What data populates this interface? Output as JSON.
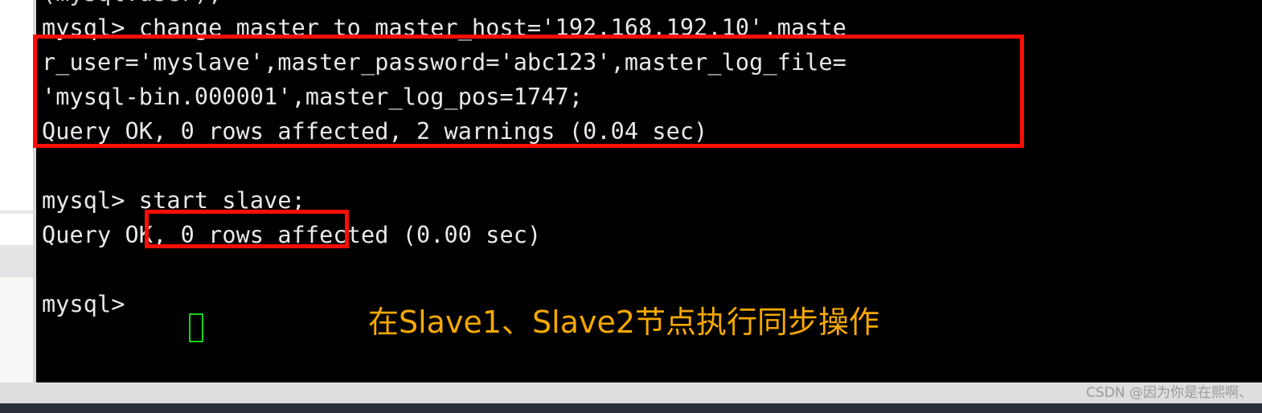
{
  "terminal": {
    "prompt": "mysql>",
    "lines": [
      {
        "text": "(mysql.user);",
        "clipped": true
      },
      {
        "text": "mysql> change master to master_host='192.168.192.10',maste",
        "clipped": false
      },
      {
        "text": "r_user='myslave',master_password='abc123',master_log_file=",
        "clipped": false
      },
      {
        "text": "'mysql-bin.000001',master_log_pos=1747;",
        "clipped": false
      },
      {
        "text": "Query OK, 0 rows affected, 2 warnings (0.04 sec)",
        "clipped": false
      },
      {
        "text": "",
        "clipped": false
      },
      {
        "text": "mysql> start slave;",
        "clipped": false
      },
      {
        "text": "Query OK, 0 rows affected (0.00 sec)",
        "clipped": false
      },
      {
        "text": "",
        "clipped": false
      },
      {
        "text": "mysql>",
        "clipped": false
      }
    ],
    "commands": {
      "change_master": "change master to master_host='192.168.192.10',master_user='myslave',master_password='abc123',master_log_file='mysql-bin.000001',master_log_pos=1747;",
      "start_slave": "start slave;"
    },
    "results": {
      "change_master_result": "Query OK, 0 rows affected, 2 warnings (0.04 sec)",
      "start_slave_result": "Query OK, 0 rows affected (0.00 sec)"
    },
    "background_color": "#000000",
    "text_color": "#e9e9e9",
    "cursor_color": "#15d415"
  },
  "annotations": {
    "highlight_color": "#fb0e06",
    "note_color": "#f5a800",
    "note_text": "在Slave1、Slave2节点执行同步操作",
    "boxes": [
      {
        "label": "change-master-command"
      },
      {
        "label": "start-slave-command"
      }
    ]
  },
  "footer": {
    "watermark": "CSDN @因为你是在熙啊、",
    "band_color": "#dededf",
    "bar_color": "#2b2f3c"
  }
}
